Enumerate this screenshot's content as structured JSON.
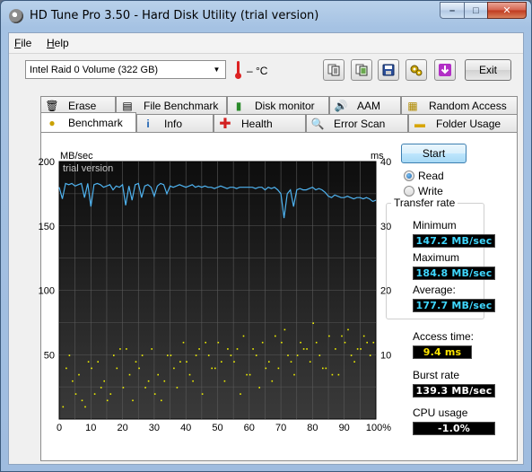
{
  "window": {
    "title": "HD Tune Pro 3.50 - Hard Disk Utility (trial version)",
    "minimize_glyph": "–",
    "maximize_glyph": "□",
    "close_glyph": "✕"
  },
  "menu": [
    {
      "label": "File",
      "accel": "F"
    },
    {
      "label": "Help",
      "accel": "H"
    }
  ],
  "toolbar": {
    "drive": "Intel  Raid 0 Volume (322 GB)",
    "temperature": "– °C",
    "exit_label": "Exit",
    "icons": [
      "copy-info-icon",
      "copy-screen-icon",
      "save-icon",
      "options-icon",
      "download-icon"
    ]
  },
  "tabs_top": [
    {
      "label": "Erase",
      "icon": "erase-icon"
    },
    {
      "label": "File Benchmark",
      "icon": "file-benchmark-icon"
    },
    {
      "label": "Disk monitor",
      "icon": "disk-monitor-icon"
    },
    {
      "label": "AAM",
      "icon": "aam-speaker-icon"
    },
    {
      "label": "Random Access",
      "icon": "random-access-icon"
    }
  ],
  "tabs_bottom": [
    {
      "label": "Benchmark",
      "icon": "benchmark-icon",
      "active": true
    },
    {
      "label": "Info",
      "icon": "info-icon",
      "active": false
    },
    {
      "label": "Health",
      "icon": "health-icon",
      "active": false
    },
    {
      "label": "Error Scan",
      "icon": "error-scan-icon",
      "active": false
    },
    {
      "label": "Folder Usage",
      "icon": "folder-usage-icon",
      "active": false
    }
  ],
  "benchmark": {
    "start_label": "Start",
    "mode_read": "Read",
    "mode_write": "Write",
    "selected_mode": "Read",
    "transfer_rate_title": "Transfer rate",
    "minimum_label": "Minimum",
    "minimum_value": "147.2 MB/sec",
    "maximum_label": "Maximum",
    "maximum_value": "184.8 MB/sec",
    "average_label": "Average:",
    "average_value": "177.7 MB/sec",
    "access_time_label": "Access time:",
    "access_time_value": "9.4 ms",
    "burst_rate_label": "Burst rate",
    "burst_rate_value": "139.3 MB/sec",
    "cpu_usage_label": "CPU usage",
    "cpu_usage_value": "-1.0%"
  },
  "chart_data": {
    "type": "line",
    "watermark": "trial version",
    "ylabel_left": "MB/sec",
    "ylabel_right": "ms",
    "ylim_left": [
      0,
      200
    ],
    "ylim_right": [
      0,
      40
    ],
    "left_ticks": [
      "200",
      "150",
      "100",
      "50"
    ],
    "right_ticks": [
      "40",
      "30",
      "20",
      "10"
    ],
    "x_ticks": [
      "0",
      "10",
      "20",
      "30",
      "40",
      "50",
      "60",
      "70",
      "80",
      "90",
      "100%"
    ],
    "grid": true,
    "colors": {
      "background": "#1c1c1c",
      "grid": "#5a5a5a",
      "transfer": "#4fb3f0",
      "access": "#f0f000"
    },
    "series": [
      {
        "axis": "left",
        "x": [
          0,
          1,
          2,
          3,
          4,
          5,
          6,
          7,
          8,
          9,
          10,
          11,
          12,
          13,
          14,
          15,
          16,
          17,
          18,
          19,
          20,
          21,
          22,
          23,
          24,
          25,
          26,
          27,
          28,
          29,
          30,
          31,
          32,
          33,
          34,
          35,
          36,
          37,
          38,
          39,
          40,
          41,
          42,
          43,
          44,
          45,
          46,
          47,
          48,
          49,
          50,
          51,
          52,
          53,
          54,
          55,
          56,
          57,
          58,
          59,
          60,
          61,
          62,
          63,
          64,
          65,
          66,
          67,
          68,
          69,
          70,
          71,
          72,
          73,
          74,
          75,
          76,
          77,
          78,
          79,
          80,
          81,
          82,
          83,
          84,
          85,
          86,
          87,
          88,
          89,
          90,
          91,
          92,
          93,
          94,
          95,
          96,
          97,
          98,
          99,
          100
        ],
        "values": [
          180,
          171,
          183,
          182,
          183,
          181,
          182,
          183,
          172,
          183,
          165,
          182,
          183,
          182,
          180,
          181,
          182,
          178,
          181,
          180,
          182,
          166,
          181,
          170,
          182,
          183,
          172,
          181,
          182,
          180,
          173,
          181,
          183,
          182,
          175,
          181,
          180,
          181,
          182,
          181,
          180,
          181,
          182,
          180,
          181,
          180,
          181,
          180,
          180,
          179,
          180,
          181,
          180,
          179,
          180,
          180,
          179,
          180,
          180,
          180,
          180,
          180,
          179,
          180,
          180,
          178,
          180,
          179,
          180,
          178,
          175,
          156,
          175,
          178,
          165,
          178,
          179,
          178,
          178,
          179,
          180,
          178,
          179,
          178,
          176,
          173,
          172,
          174,
          173,
          172,
          172,
          173,
          172,
          171,
          172,
          172,
          171,
          172,
          171,
          169,
          170
        ]
      },
      {
        "axis": "right",
        "x": [
          1,
          3,
          5,
          6,
          8,
          9,
          11,
          12,
          14,
          15,
          17,
          18,
          20,
          21,
          23,
          25,
          26,
          28,
          29,
          31,
          32,
          34,
          36,
          37,
          39,
          40,
          42,
          44,
          45,
          47,
          49,
          50,
          52,
          53,
          55,
          57,
          58,
          60,
          61,
          63,
          64,
          66,
          68,
          69,
          71,
          72,
          74,
          76,
          77,
          79,
          80,
          82,
          84,
          85,
          87,
          88,
          90,
          91,
          93,
          95,
          96,
          98,
          99,
          2,
          4,
          7,
          10,
          13,
          16,
          19,
          22,
          24,
          27,
          30,
          33,
          35,
          38,
          41,
          43,
          46,
          48,
          51,
          54,
          56,
          59,
          62,
          65,
          67,
          70,
          73,
          75,
          78,
          81,
          83,
          86,
          89,
          92,
          94,
          97
        ],
        "values": [
          2,
          10,
          4,
          7,
          2,
          9,
          4,
          9,
          6,
          3,
          10,
          8,
          5,
          11,
          3,
          8,
          10,
          6,
          11,
          7,
          3,
          10,
          8,
          5,
          12,
          9,
          6,
          11,
          4,
          10,
          8,
          12,
          6,
          11,
          9,
          4,
          13,
          7,
          11,
          5,
          12,
          9,
          13,
          8,
          14,
          10,
          7,
          12,
          11,
          9,
          15,
          10,
          8,
          13,
          11,
          7,
          12,
          14,
          9,
          11,
          13,
          10,
          12,
          8,
          6,
          3,
          8,
          5,
          4,
          11,
          7,
          9,
          5,
          4,
          6,
          10,
          9,
          7,
          10,
          12,
          8,
          9,
          10,
          11,
          7,
          10,
          8,
          6,
          12,
          9,
          10,
          11,
          12,
          8,
          7,
          13,
          10,
          11,
          12
        ]
      }
    ]
  }
}
